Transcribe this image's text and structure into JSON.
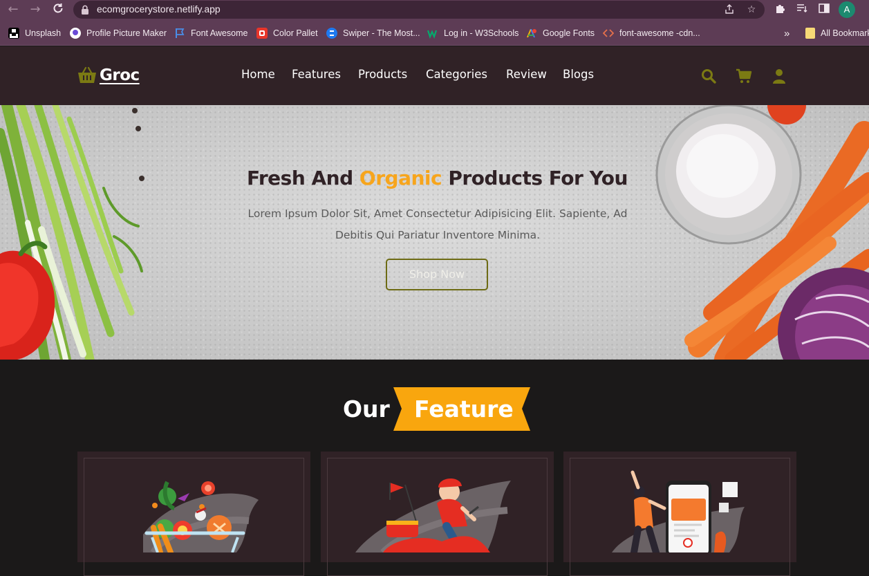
{
  "browser": {
    "url": "ecomgrocerystore.netlify.app",
    "profile_initial": "A",
    "bookmarks": [
      {
        "label": "Unsplash",
        "icon": "unsplash-icon"
      },
      {
        "label": "Profile Picture Maker",
        "icon": "profile-maker-icon"
      },
      {
        "label": "Font Awesome",
        "icon": "flag-icon"
      },
      {
        "label": "Color Pallet",
        "icon": "color-pallet-icon"
      },
      {
        "label": "Swiper - The Most...",
        "icon": "swiper-icon"
      },
      {
        "label": "Log in - W3Schools",
        "icon": "w3schools-icon"
      },
      {
        "label": "Google Fonts",
        "icon": "google-fonts-icon"
      },
      {
        "label": "font-awesome -cdn...",
        "icon": "code-icon"
      }
    ],
    "more_bookmarks": "»",
    "all_bookmarks": "All Bookmarks"
  },
  "site": {
    "logo": "Groc",
    "nav": [
      "Home",
      "Features",
      "Products",
      "Categories",
      "Review",
      "Blogs"
    ],
    "icons": [
      "search-icon",
      "cart-icon",
      "user-icon"
    ],
    "accent_color": "#7b7a13"
  },
  "hero": {
    "title_before": "Fresh And ",
    "title_accent": "Organic",
    "title_after": " Products For You",
    "description": "Lorem Ipsum Dolor Sit, Amet Consectetur Adipisicing Elit. Sapiente, Ad Debitis Qui Pariatur Inventore Minima.",
    "button": "Shop Now",
    "accent_color": "#f7a51c"
  },
  "features": {
    "heading_plain": "Our",
    "heading_highlight": "Feature",
    "highlight_color": "#f9a60e",
    "cards": [
      {
        "illustration": "fresh-vegetables-basket"
      },
      {
        "illustration": "delivery-scooter-rider"
      },
      {
        "illustration": "mobile-payment-person"
      }
    ]
  }
}
